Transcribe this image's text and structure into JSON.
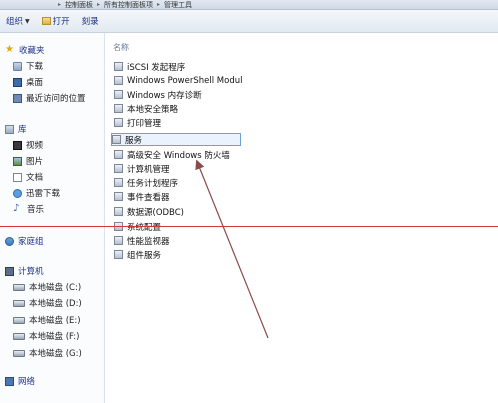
{
  "breadcrumb": [
    "控制面板",
    "所有控制面板项",
    "管理工具"
  ],
  "toolbar": {
    "organize": "组织",
    "open": "打开",
    "burn": "刻录"
  },
  "nav": {
    "favorites": "收藏夹",
    "downloads": "下载",
    "desktop": "桌面",
    "recent": "最近访问的位置",
    "library": "库",
    "videos": "视频",
    "pictures": "图片",
    "documents": "文档",
    "xunlei": "迅雷下载",
    "music": "音乐",
    "homegroup": "家庭组",
    "computer": "计算机",
    "drives": [
      "本地磁盘 (C:)",
      "本地磁盘 (D:)",
      "本地磁盘 (E:)",
      "本地磁盘 (F:)",
      "本地磁盘 (G:)"
    ],
    "network": "网络"
  },
  "content": {
    "column_header": "名称",
    "items": [
      "iSCSI 发起程序",
      "Windows PowerShell Modul",
      "Windows 内存诊断",
      "本地安全策略",
      "打印管理",
      "服务",
      "高级安全 Windows 防火墙",
      "计算机管理",
      "任务计划程序",
      "事件查看器",
      "数据源(ODBC)",
      "系统配置",
      "性能监视器",
      "组件服务"
    ],
    "selected_item": "服务"
  },
  "colors": {
    "annotation_line": "#d33b3b",
    "arrow": "#8a4a4a",
    "selection_border": "#6fa0d8"
  }
}
